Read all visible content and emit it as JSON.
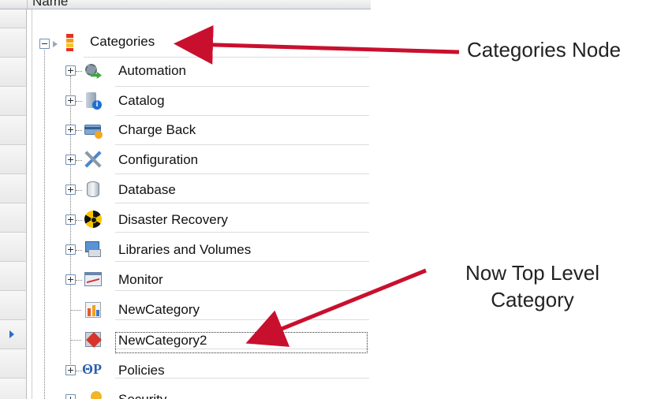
{
  "header": {
    "column_name": "Name"
  },
  "tree": {
    "root": {
      "label": "Categories"
    },
    "items": [
      {
        "label": "Automation"
      },
      {
        "label": "Catalog"
      },
      {
        "label": "Charge Back"
      },
      {
        "label": "Configuration"
      },
      {
        "label": "Database"
      },
      {
        "label": "Disaster Recovery"
      },
      {
        "label": "Libraries and Volumes"
      },
      {
        "label": "Monitor"
      },
      {
        "label": "NewCategory"
      },
      {
        "label": "NewCategory2"
      },
      {
        "label": "Policies"
      },
      {
        "label": "Security"
      }
    ]
  },
  "annotations": {
    "categories_node": "Categories Node",
    "top_level_line1": "Now Top Level",
    "top_level_line2": "Category",
    "arrow_color": "#c8102e"
  }
}
